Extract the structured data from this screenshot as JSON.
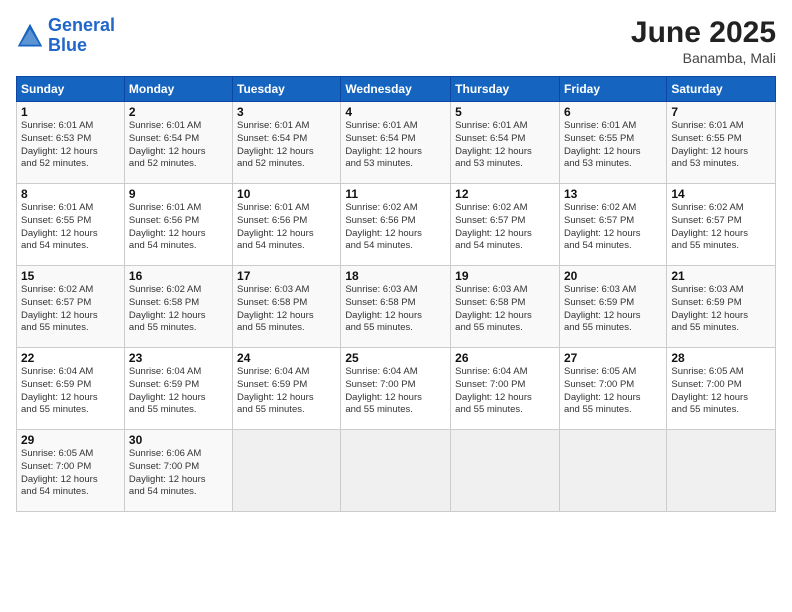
{
  "header": {
    "logo_line1": "General",
    "logo_line2": "Blue",
    "month": "June 2025",
    "location": "Banamba, Mali"
  },
  "weekdays": [
    "Sunday",
    "Monday",
    "Tuesday",
    "Wednesday",
    "Thursday",
    "Friday",
    "Saturday"
  ],
  "weeks": [
    [
      {
        "day": "1",
        "info": "Sunrise: 6:01 AM\nSunset: 6:53 PM\nDaylight: 12 hours\nand 52 minutes."
      },
      {
        "day": "2",
        "info": "Sunrise: 6:01 AM\nSunset: 6:54 PM\nDaylight: 12 hours\nand 52 minutes."
      },
      {
        "day": "3",
        "info": "Sunrise: 6:01 AM\nSunset: 6:54 PM\nDaylight: 12 hours\nand 52 minutes."
      },
      {
        "day": "4",
        "info": "Sunrise: 6:01 AM\nSunset: 6:54 PM\nDaylight: 12 hours\nand 53 minutes."
      },
      {
        "day": "5",
        "info": "Sunrise: 6:01 AM\nSunset: 6:54 PM\nDaylight: 12 hours\nand 53 minutes."
      },
      {
        "day": "6",
        "info": "Sunrise: 6:01 AM\nSunset: 6:55 PM\nDaylight: 12 hours\nand 53 minutes."
      },
      {
        "day": "7",
        "info": "Sunrise: 6:01 AM\nSunset: 6:55 PM\nDaylight: 12 hours\nand 53 minutes."
      }
    ],
    [
      {
        "day": "8",
        "info": "Sunrise: 6:01 AM\nSunset: 6:55 PM\nDaylight: 12 hours\nand 54 minutes."
      },
      {
        "day": "9",
        "info": "Sunrise: 6:01 AM\nSunset: 6:56 PM\nDaylight: 12 hours\nand 54 minutes."
      },
      {
        "day": "10",
        "info": "Sunrise: 6:01 AM\nSunset: 6:56 PM\nDaylight: 12 hours\nand 54 minutes."
      },
      {
        "day": "11",
        "info": "Sunrise: 6:02 AM\nSunset: 6:56 PM\nDaylight: 12 hours\nand 54 minutes."
      },
      {
        "day": "12",
        "info": "Sunrise: 6:02 AM\nSunset: 6:57 PM\nDaylight: 12 hours\nand 54 minutes."
      },
      {
        "day": "13",
        "info": "Sunrise: 6:02 AM\nSunset: 6:57 PM\nDaylight: 12 hours\nand 54 minutes."
      },
      {
        "day": "14",
        "info": "Sunrise: 6:02 AM\nSunset: 6:57 PM\nDaylight: 12 hours\nand 55 minutes."
      }
    ],
    [
      {
        "day": "15",
        "info": "Sunrise: 6:02 AM\nSunset: 6:57 PM\nDaylight: 12 hours\nand 55 minutes."
      },
      {
        "day": "16",
        "info": "Sunrise: 6:02 AM\nSunset: 6:58 PM\nDaylight: 12 hours\nand 55 minutes."
      },
      {
        "day": "17",
        "info": "Sunrise: 6:03 AM\nSunset: 6:58 PM\nDaylight: 12 hours\nand 55 minutes."
      },
      {
        "day": "18",
        "info": "Sunrise: 6:03 AM\nSunset: 6:58 PM\nDaylight: 12 hours\nand 55 minutes."
      },
      {
        "day": "19",
        "info": "Sunrise: 6:03 AM\nSunset: 6:58 PM\nDaylight: 12 hours\nand 55 minutes."
      },
      {
        "day": "20",
        "info": "Sunrise: 6:03 AM\nSunset: 6:59 PM\nDaylight: 12 hours\nand 55 minutes."
      },
      {
        "day": "21",
        "info": "Sunrise: 6:03 AM\nSunset: 6:59 PM\nDaylight: 12 hours\nand 55 minutes."
      }
    ],
    [
      {
        "day": "22",
        "info": "Sunrise: 6:04 AM\nSunset: 6:59 PM\nDaylight: 12 hours\nand 55 minutes."
      },
      {
        "day": "23",
        "info": "Sunrise: 6:04 AM\nSunset: 6:59 PM\nDaylight: 12 hours\nand 55 minutes."
      },
      {
        "day": "24",
        "info": "Sunrise: 6:04 AM\nSunset: 6:59 PM\nDaylight: 12 hours\nand 55 minutes."
      },
      {
        "day": "25",
        "info": "Sunrise: 6:04 AM\nSunset: 7:00 PM\nDaylight: 12 hours\nand 55 minutes."
      },
      {
        "day": "26",
        "info": "Sunrise: 6:04 AM\nSunset: 7:00 PM\nDaylight: 12 hours\nand 55 minutes."
      },
      {
        "day": "27",
        "info": "Sunrise: 6:05 AM\nSunset: 7:00 PM\nDaylight: 12 hours\nand 55 minutes."
      },
      {
        "day": "28",
        "info": "Sunrise: 6:05 AM\nSunset: 7:00 PM\nDaylight: 12 hours\nand 55 minutes."
      }
    ],
    [
      {
        "day": "29",
        "info": "Sunrise: 6:05 AM\nSunset: 7:00 PM\nDaylight: 12 hours\nand 54 minutes."
      },
      {
        "day": "30",
        "info": "Sunrise: 6:06 AM\nSunset: 7:00 PM\nDaylight: 12 hours\nand 54 minutes."
      },
      {
        "day": "",
        "info": ""
      },
      {
        "day": "",
        "info": ""
      },
      {
        "day": "",
        "info": ""
      },
      {
        "day": "",
        "info": ""
      },
      {
        "day": "",
        "info": ""
      }
    ]
  ]
}
